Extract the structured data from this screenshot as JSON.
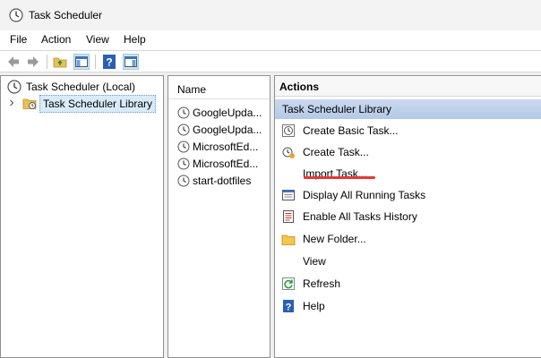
{
  "window": {
    "title": "Task Scheduler"
  },
  "menu": [
    "File",
    "Action",
    "View",
    "Help"
  ],
  "toolbar": {
    "icons": [
      "back-arrow-icon",
      "forward-arrow-icon",
      "folder-up-icon",
      "show-hide-tree-icon",
      "help-icon",
      "show-hide-action-pane-icon"
    ]
  },
  "tree": {
    "root": "Task Scheduler (Local)",
    "library": "Task Scheduler Library"
  },
  "list": {
    "header": "Name",
    "items": [
      "GoogleUpda...",
      "GoogleUpda...",
      "MicrosoftEd...",
      "MicrosoftEd...",
      "start-dotfiles"
    ]
  },
  "actions": {
    "title": "Actions",
    "section": "Task Scheduler Library",
    "items": [
      {
        "label": "Create Basic Task...",
        "icon": "create-basic-task-icon"
      },
      {
        "label": "Create Task...",
        "icon": "create-task-icon"
      },
      {
        "label": "Import Task...",
        "icon": "none"
      },
      {
        "label": "Display All Running Tasks",
        "icon": "running-tasks-icon"
      },
      {
        "label": "Enable All Tasks History",
        "icon": "tasks-history-icon"
      },
      {
        "label": "New Folder...",
        "icon": "folder-icon"
      },
      {
        "label": "View",
        "icon": "none"
      },
      {
        "label": "Refresh",
        "icon": "refresh-icon"
      },
      {
        "label": "Help",
        "icon": "help-icon"
      }
    ]
  },
  "colors": {
    "selection": "#d9ebf9",
    "section_header": "#c9d9ee",
    "annotation": "#e53935",
    "help_blue": "#2b5fb4"
  }
}
